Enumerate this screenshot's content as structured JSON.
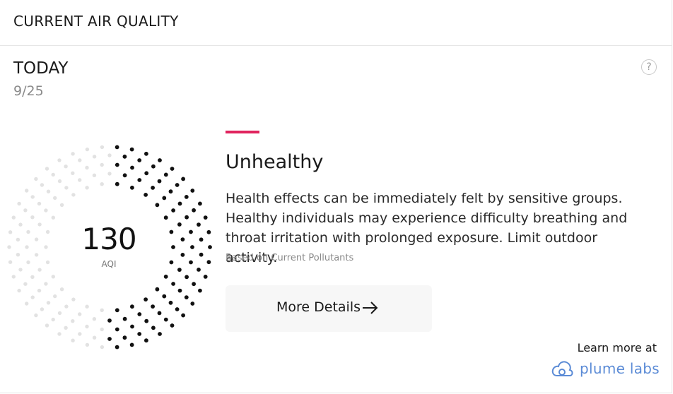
{
  "header": {
    "title": "CURRENT AIR QUALITY"
  },
  "day": {
    "label": "TODAY",
    "date": "9/25"
  },
  "help": {
    "label": "?"
  },
  "aqi": {
    "value": "130",
    "unit_label": "AQI",
    "level_fraction": 0.5,
    "active_color": "#111111",
    "inactive_color": "#e2e2e2"
  },
  "status": {
    "title": "Unhealthy",
    "accent_color": "#e0245e",
    "description": "Health effects can be immediately felt by sensitive groups. Healthy individuals may experience difficulty breathing and throat irritation with prolonged exposure. Limit outdoor activity.",
    "basis": "Based on Current Pollutants"
  },
  "details_button": {
    "label": "More Details",
    "icon": "arrow-right-icon"
  },
  "footer": {
    "learn_more": "Learn more at",
    "brand": "plume labs",
    "brand_icon": "cloud-icon",
    "brand_color": "#5b8bd6"
  }
}
